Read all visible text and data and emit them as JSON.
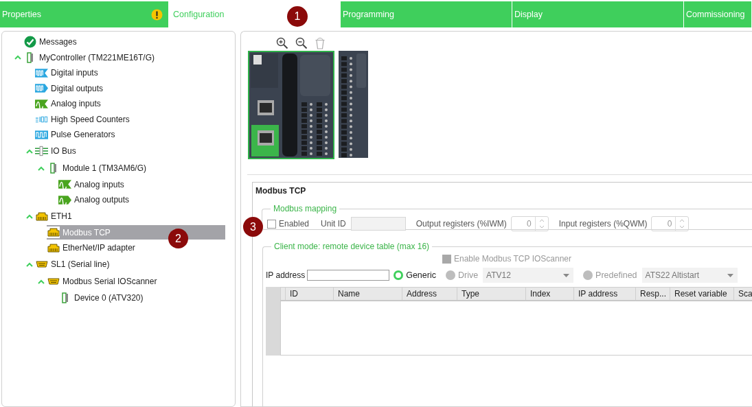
{
  "tabs": [
    {
      "label": "Properties",
      "selected": false,
      "warning": true
    },
    {
      "label": "Configuration",
      "selected": true,
      "warning": false
    },
    {
      "label": "Programming",
      "selected": false,
      "warning": false
    },
    {
      "label": "Display",
      "selected": false,
      "warning": false
    },
    {
      "label": "Commissioning",
      "selected": false,
      "warning": false
    }
  ],
  "tree": [
    {
      "label": "Messages",
      "kind": "ok",
      "selected": false
    },
    {
      "label": "MyController (TM221ME16T/G)",
      "kind": "device",
      "selected": false,
      "expanded": true,
      "children": [
        {
          "label": "Digital inputs",
          "kind": "dinput",
          "selected": false
        },
        {
          "label": "Digital outputs",
          "kind": "doutput",
          "selected": false
        },
        {
          "label": "Analog inputs",
          "kind": "ainput",
          "selected": false
        },
        {
          "label": "High Speed Counters",
          "kind": "counter",
          "selected": false
        },
        {
          "label": "Pulse Generators",
          "kind": "pulse",
          "selected": false
        },
        {
          "label": "IO Bus",
          "kind": "bus",
          "selected": false,
          "expanded": true,
          "children": [
            {
              "label": "Module 1 (TM3AM6/G)",
              "kind": "device",
              "selected": false,
              "expanded": true,
              "children": [
                {
                  "label": "Analog inputs",
                  "kind": "ainput",
                  "selected": false
                },
                {
                  "label": "Analog outputs",
                  "kind": "aoutput",
                  "selected": false
                }
              ]
            }
          ]
        },
        {
          "label": "ETH1",
          "kind": "ethernet",
          "selected": false,
          "expanded": true,
          "children": [
            {
              "label": "Modbus TCP",
              "kind": "ethernet",
              "selected": true
            },
            {
              "label": "EtherNet/IP adapter",
              "kind": "ethernet",
              "selected": false
            }
          ]
        },
        {
          "label": "SL1 (Serial line)",
          "kind": "serial",
          "selected": false,
          "expanded": true,
          "children": [
            {
              "label": "Modbus Serial IOScanner",
              "kind": "serial",
              "selected": false,
              "expanded": true,
              "children": [
                {
                  "label": "Device 0 (ATV320)",
                  "kind": "device",
                  "selected": false
                }
              ]
            }
          ]
        }
      ]
    }
  ],
  "section": {
    "title": "Modbus TCP",
    "mapping": {
      "legend": "Modbus mapping",
      "enabled": {
        "label": "Enabled",
        "checked": false
      },
      "unit_id": {
        "label": "Unit ID",
        "disabled": true
      },
      "spinners": [
        {
          "label": "Output registers (%IWM)",
          "value": "0",
          "disabled": true
        },
        {
          "label": "Input registers (%QWM)",
          "value": "0",
          "disabled": true
        }
      ]
    },
    "client": {
      "legend": "Client mode: remote device table (max 16)",
      "ioscanner": {
        "label": "Enable Modbus TCP IOScanner",
        "disabled": true
      },
      "ip_label": "IP address",
      "device_types": [
        {
          "label": "Generic",
          "selected": true,
          "disabled": false
        },
        {
          "label": "Drive",
          "selected": false,
          "disabled": true,
          "dropdown": "ATV12"
        },
        {
          "label": "Predefined",
          "selected": false,
          "disabled": true,
          "dropdown": "ATS22 Altistart"
        }
      ],
      "columns": [
        "ID",
        "Name",
        "Address",
        "Type",
        "Index",
        "IP address",
        "Resp...",
        "Reset variable",
        "Sca"
      ]
    }
  },
  "callouts": [
    {
      "label": "1"
    },
    {
      "label": "2"
    },
    {
      "label": "3"
    }
  ]
}
